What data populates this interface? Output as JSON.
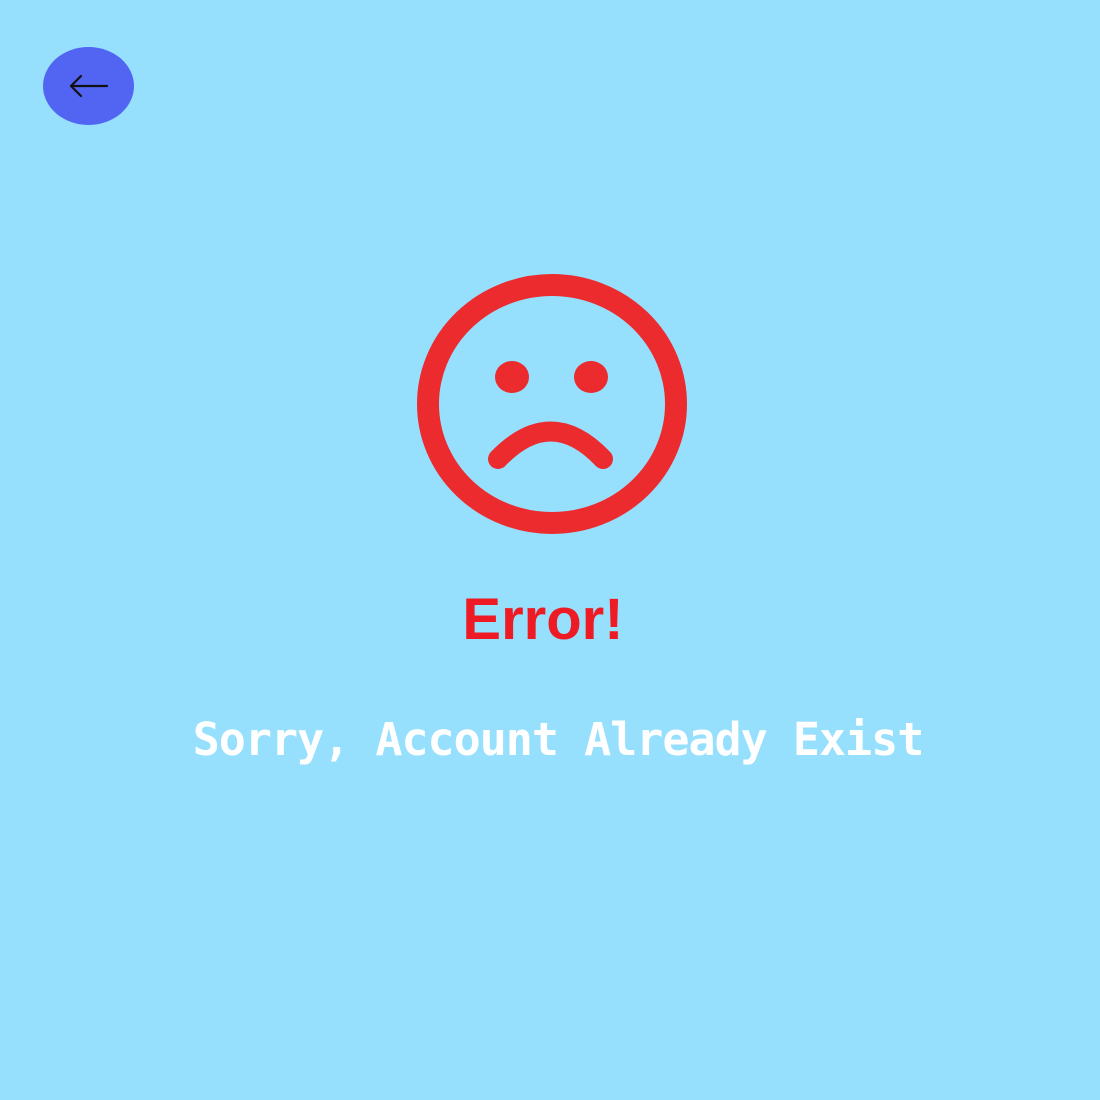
{
  "screen": {
    "background_color": "#96e0fe"
  },
  "back_button": {
    "icon": "arrow-left-icon",
    "color": "#5265f2"
  },
  "error": {
    "icon": "sad-face-icon",
    "icon_color": "#ec2b2e",
    "title": "Error!",
    "title_color": "#ee1b24",
    "message": "Sorry, Account Already Exist",
    "message_color": "#ffffff"
  }
}
